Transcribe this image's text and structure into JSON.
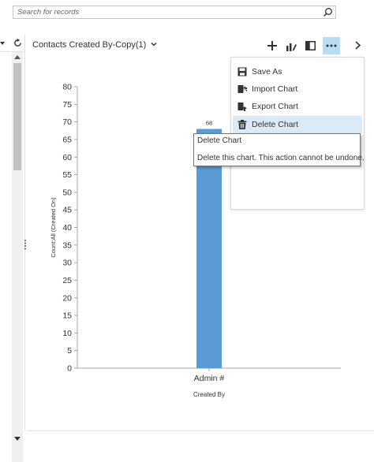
{
  "search": {
    "placeholder": "Search for records"
  },
  "chart_header": {
    "title": "Contacts Created By-Copy(1)"
  },
  "toolbar": {
    "new_label": "+",
    "more_label": "•••"
  },
  "menu": {
    "items": [
      {
        "label": "Save As",
        "icon": "save-icon"
      },
      {
        "label": "Import Chart",
        "icon": "import-icon"
      },
      {
        "label": "Export Chart",
        "icon": "export-icon"
      },
      {
        "label": "Delete Chart",
        "icon": "trash-icon"
      }
    ]
  },
  "tooltip": {
    "title": "Delete Chart",
    "description": "Delete this chart. This action cannot be undone."
  },
  "colors": {
    "bar": "#5b9bd5",
    "accent": "#b9dcf2",
    "menu_hover": "#dbeaf7"
  },
  "chart_data": {
    "type": "bar",
    "categories": [
      "Admin #"
    ],
    "values": [
      68
    ],
    "data_labels": [
      "68"
    ],
    "xlabel": "Created By",
    "ylabel": "Count:All (Created On)",
    "ylim": [
      0,
      80
    ],
    "yticks": [
      0,
      5,
      10,
      15,
      20,
      25,
      30,
      35,
      40,
      45,
      50,
      55,
      60,
      65,
      70,
      75,
      80
    ],
    "grid": false
  }
}
